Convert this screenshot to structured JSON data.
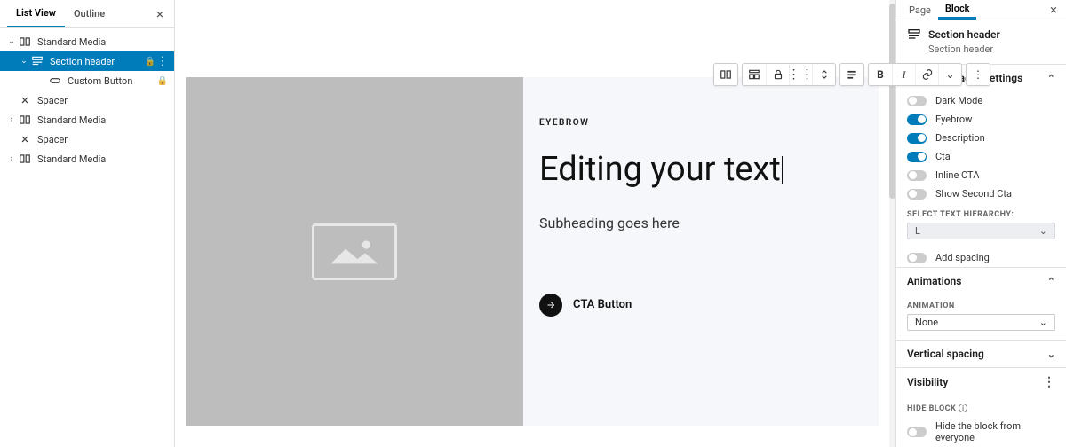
{
  "left": {
    "tabs": {
      "list_view": "List View",
      "outline": "Outline"
    },
    "tree": [
      {
        "level": 1,
        "caret": "v",
        "icon": "columns",
        "label": "Standard Media",
        "lock": false
      },
      {
        "level": 2,
        "caret": "v",
        "icon": "header",
        "label": "Section header",
        "lock": true,
        "selected": true,
        "menu": true
      },
      {
        "level": 3,
        "caret": "",
        "icon": "button",
        "label": "Custom Button",
        "lock": true
      },
      {
        "level": 1,
        "caret": "",
        "icon": "spacer",
        "label": "Spacer",
        "lock": false
      },
      {
        "level": 1,
        "caret": ">",
        "icon": "columns",
        "label": "Standard Media",
        "lock": false
      },
      {
        "level": 1,
        "caret": "",
        "icon": "spacer",
        "label": "Spacer",
        "lock": false
      },
      {
        "level": 1,
        "caret": ">",
        "icon": "columns",
        "label": "Standard Media",
        "lock": false
      }
    ]
  },
  "canvas": {
    "eyebrow": "EYEBROW",
    "heading": "Editing your text",
    "subheading": "Subheading goes here",
    "cta": "CTA Button"
  },
  "right": {
    "tabs": {
      "page": "Page",
      "block": "Block"
    },
    "block_name": "Section header",
    "block_sub": "Section header",
    "sec_settings": "Section Header Settings",
    "toggles": {
      "dark_mode": "Dark Mode",
      "eyebrow": "Eyebrow",
      "description": "Description",
      "cta": "Cta",
      "inline_cta": "Inline CTA",
      "show_second": "Show Second Cta"
    },
    "select_hierarchy_label": "SELECT TEXT HIERARCHY:",
    "select_hierarchy_value": "L",
    "add_spacing": "Add spacing",
    "animations": "Animations",
    "animation_label": "ANIMATION",
    "animation_value": "None",
    "vertical_spacing": "Vertical spacing",
    "visibility": "Visibility",
    "hide_block_label": "HIDE BLOCK",
    "hide_block_toggle": "Hide the block from everyone"
  }
}
